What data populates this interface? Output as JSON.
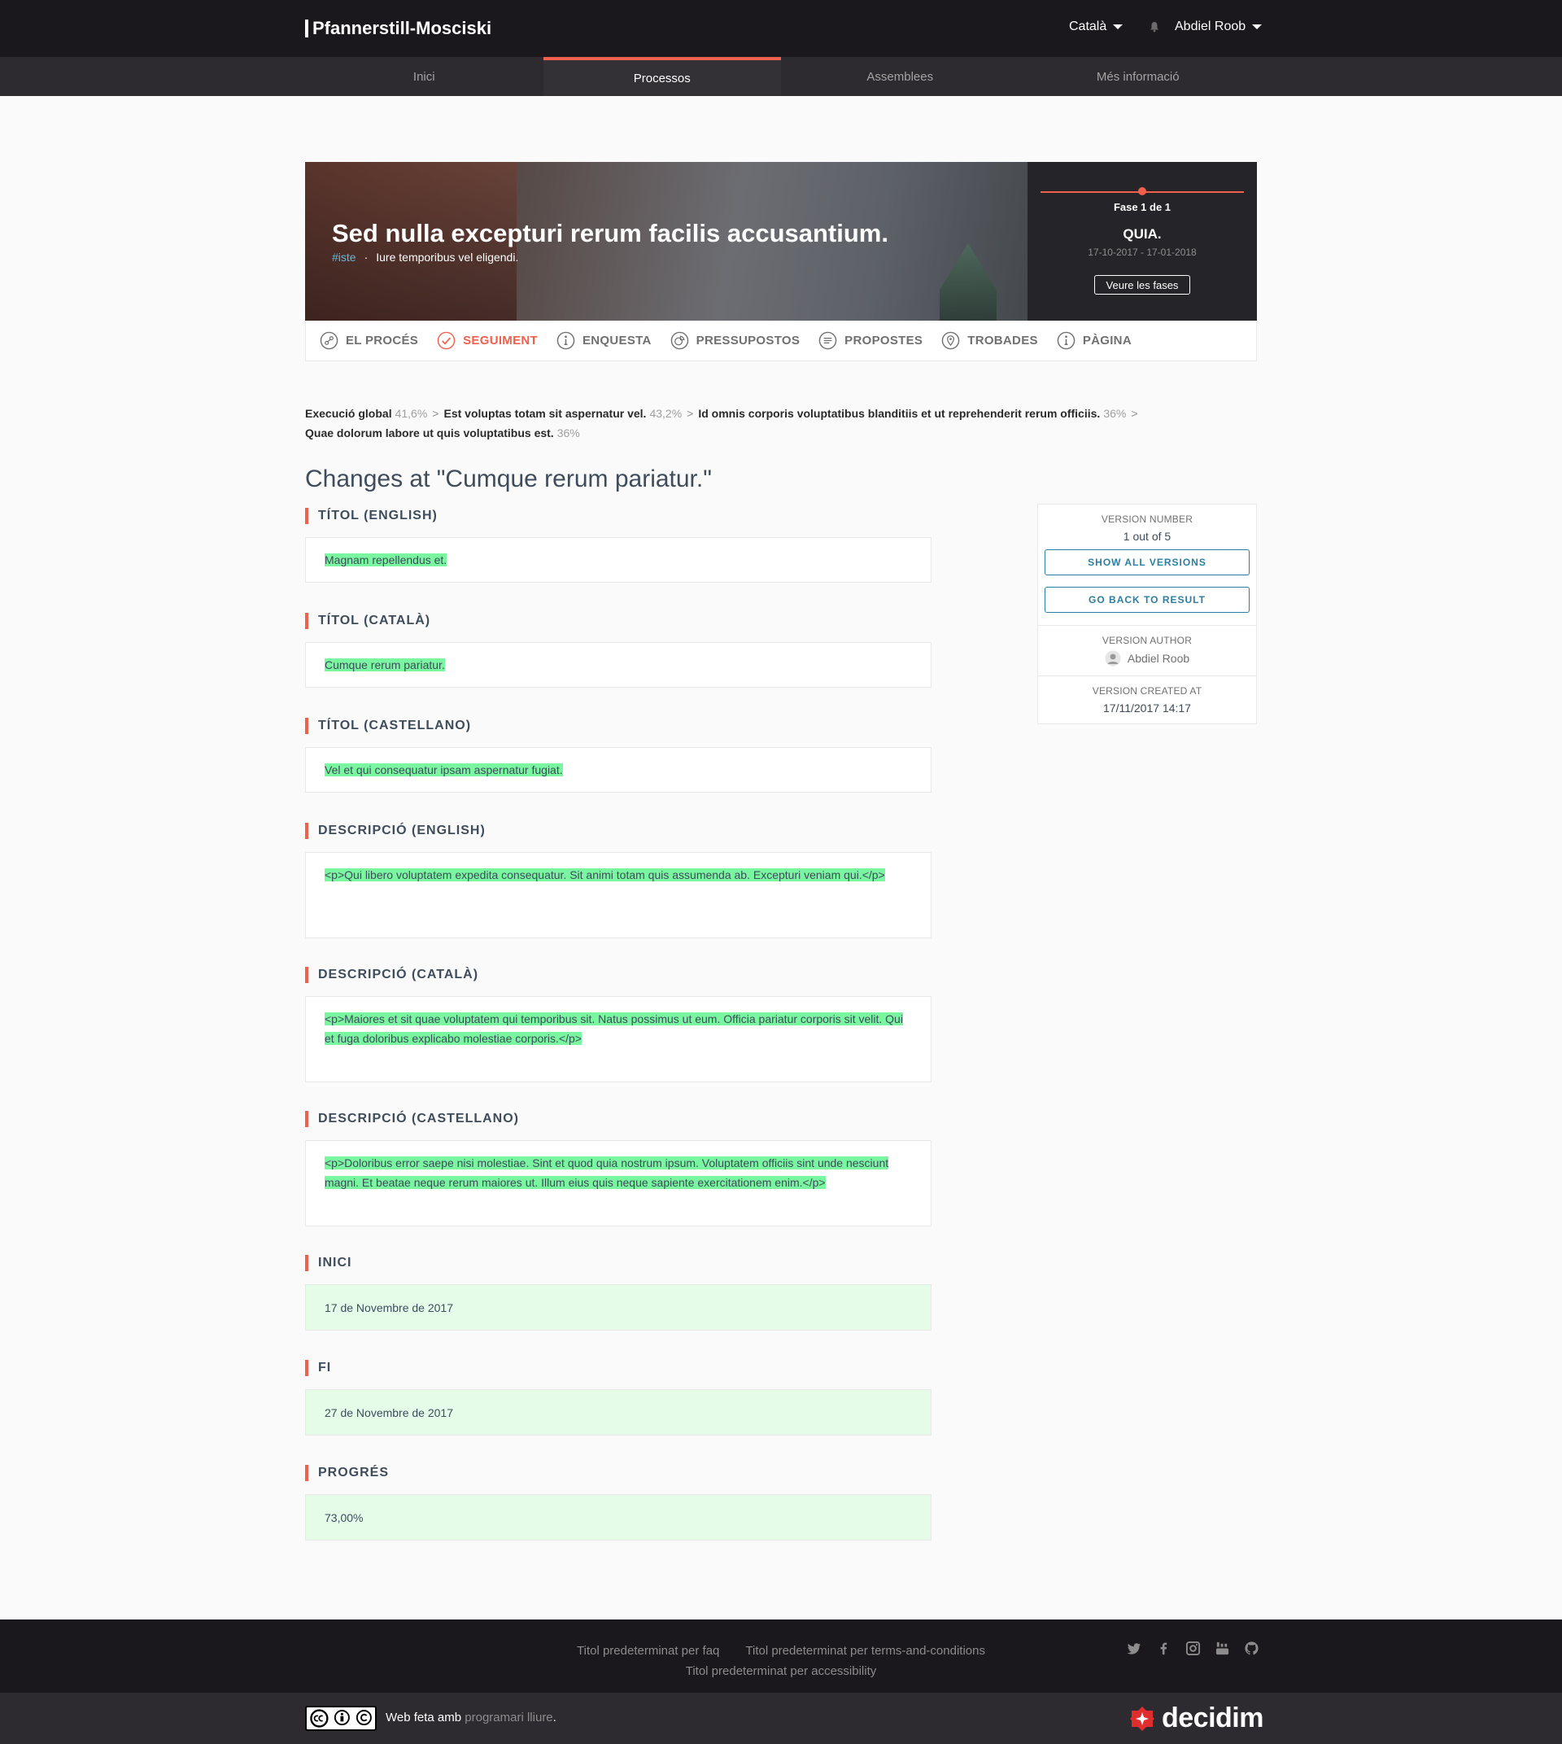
{
  "header": {
    "org_name": "Pfannerstill-Mosciski",
    "language": "Català",
    "user_name": "Abdiel Roob"
  },
  "main_nav": [
    {
      "label": "Inici",
      "active": false
    },
    {
      "label": "Processos",
      "active": true
    },
    {
      "label": "Assemblees",
      "active": false
    },
    {
      "label": "Més informació",
      "active": false
    }
  ],
  "hero": {
    "title": "Sed nulla excepturi rerum facilis accusantium.",
    "hashtag": "#iste",
    "subtitle": "Iure temporibus vel eligendi.",
    "phase_label": "Fase 1 de 1",
    "phase_name": "QUIA.",
    "phase_dates": "17-10-2017 - 17-01-2018",
    "phases_button": "Veure les fases"
  },
  "process_nav": [
    {
      "label": "EL PROCÉS",
      "icon": "process-icon",
      "active": false
    },
    {
      "label": "SEGUIMENT",
      "icon": "check-icon",
      "active": true
    },
    {
      "label": "ENQUESTA",
      "icon": "info-icon",
      "active": false
    },
    {
      "label": "PRESSUPOSTOS",
      "icon": "budget-icon",
      "active": false
    },
    {
      "label": "PROPOSTES",
      "icon": "proposals-icon",
      "active": false
    },
    {
      "label": "TROBADES",
      "icon": "location-pin-icon",
      "active": false
    },
    {
      "label": "PÀGINA",
      "icon": "info-icon",
      "active": false
    }
  ],
  "breadcrumb": [
    {
      "name": "Execució global",
      "pct": "41,6%"
    },
    {
      "name": "Est voluptas totam sit aspernatur vel.",
      "pct": "43,2%"
    },
    {
      "name": "Id omnis corporis voluptatibus blanditiis et ut reprehenderit rerum officiis.",
      "pct": "36%"
    },
    {
      "name": "Quae dolorum labore ut quis voluptatibus est.",
      "pct": "36%"
    }
  ],
  "page_title": "Changes at \"Cumque rerum pariatur.\"",
  "diffs": [
    {
      "label": "TÍTOL (ENGLISH)",
      "value": "Magnam repellendus et."
    },
    {
      "label": "TÍTOL (CATALÀ)",
      "value": "Cumque rerum pariatur."
    },
    {
      "label": "TÍTOL (CASTELLANO)",
      "value": "Vel et qui consequatur ipsam aspernatur fugiat."
    },
    {
      "label": "DESCRIPCIÓ (ENGLISH)",
      "value": "<p>Qui libero voluptatem expedita consequatur. Sit animi totam quis assumenda ab. Excepturi veniam qui.</p>"
    },
    {
      "label": "DESCRIPCIÓ (CATALÀ)",
      "value": "<p>Maiores et sit quae voluptatem qui temporibus sit. Natus possimus ut eum. Officia pariatur corporis sit velit. Qui et fuga doloribus explicabo molestiae corporis.</p>"
    },
    {
      "label": "DESCRIPCIÓ (CASTELLANO)",
      "value": "<p>Doloribus error saepe nisi molestiae. Sint et quod quia nostrum ipsum. Voluptatem officiis sint unde nesciunt magni. Et beatae neque rerum maiores ut. Illum eius quis neque sapiente exercitationem enim.</p>"
    },
    {
      "label": "INICI",
      "value": "17 de Novembre de 2017"
    },
    {
      "label": "FI",
      "value": "27 de Novembre de 2017"
    },
    {
      "label": "PROGRÉS",
      "value": "73,00%"
    }
  ],
  "version_card": {
    "number_caption": "VERSION NUMBER",
    "number_value": "1 out of 5",
    "show_all_button": "SHOW ALL VERSIONS",
    "back_button": "GO BACK TO RESULT",
    "author_caption": "VERSION AUTHOR",
    "author_name": "Abdiel Roob",
    "created_caption": "VERSION CREATED AT",
    "created_value": "17/11/2017 14:17"
  },
  "footer": {
    "links": [
      "Titol predeterminat per faq",
      "Titol predeterminat per terms-and-conditions",
      "Titol predeterminat per accessibility"
    ],
    "social_icons": [
      "twitter-icon",
      "facebook-icon",
      "instagram-icon",
      "youtube-icon",
      "github-icon"
    ],
    "made_with": "Web feta amb",
    "free_software": "programari lliure",
    "made_suffix": ".",
    "brand": "decidim"
  },
  "colors": {
    "accent": "#ef604d",
    "link": "#2a7fa3",
    "diff_insert": "#7af6a0",
    "diff_flat": "#e5fce9",
    "header_bg": "#1a181d"
  }
}
